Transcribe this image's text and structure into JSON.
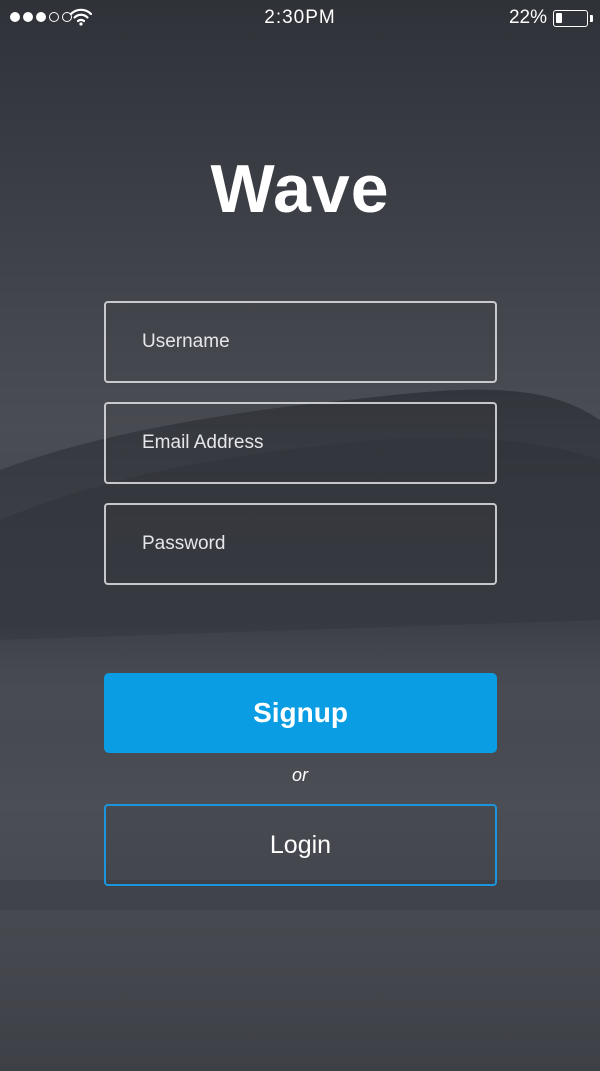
{
  "status_bar": {
    "time": "2:30PM",
    "battery_percent": "22%",
    "battery_level": 0.22,
    "signal_bars_on": 3,
    "signal_bars_total": 5,
    "wifi_icon": "wifi-icon"
  },
  "app": {
    "title": "Wave"
  },
  "form": {
    "username_placeholder": "Username",
    "email_placeholder": "Email Address",
    "password_placeholder": "Password",
    "signup_label": "Signup",
    "or_label": "or",
    "login_label": "Login"
  },
  "colors": {
    "accent": "#0b9de4",
    "login_border": "#1c95dc",
    "background": "#3f4249"
  }
}
